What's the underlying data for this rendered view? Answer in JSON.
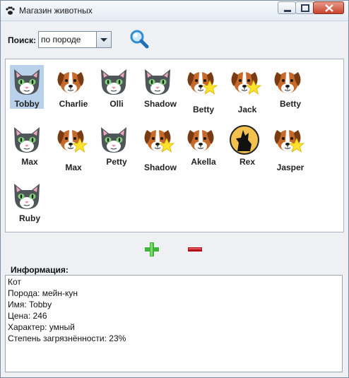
{
  "window": {
    "title": "Магазин животных",
    "accent": "#c8432c"
  },
  "search": {
    "label": "Поиск:",
    "mode": "по породе"
  },
  "pets": [
    {
      "name": "Tobby",
      "kind": "cat"
    },
    {
      "name": "Charlie",
      "kind": "dog"
    },
    {
      "name": "Olli",
      "kind": "cat"
    },
    {
      "name": "Shadow",
      "kind": "cat"
    },
    {
      "name": "Betty",
      "kind": "dog-star"
    },
    {
      "name": "Jack",
      "kind": "dog-star"
    },
    {
      "name": "Betty",
      "kind": "dog"
    },
    {
      "name": "Max",
      "kind": "cat"
    },
    {
      "name": "Max",
      "kind": "dog-star"
    },
    {
      "name": "Petty",
      "kind": "cat"
    },
    {
      "name": "Shadow",
      "kind": "dog-star"
    },
    {
      "name": "Akella",
      "kind": "dog"
    },
    {
      "name": "Rex",
      "kind": "wolf"
    },
    {
      "name": "Jasper",
      "kind": "dog-star"
    },
    {
      "name": "Ruby",
      "kind": "cat"
    }
  ],
  "info": {
    "label": "Информация:",
    "lines": [
      "Кот",
      "Порода: мейн-кун",
      "Имя: Tobby",
      "Цена: 246",
      "Характер: умный",
      "Степень загрязнённости: 23%"
    ]
  }
}
